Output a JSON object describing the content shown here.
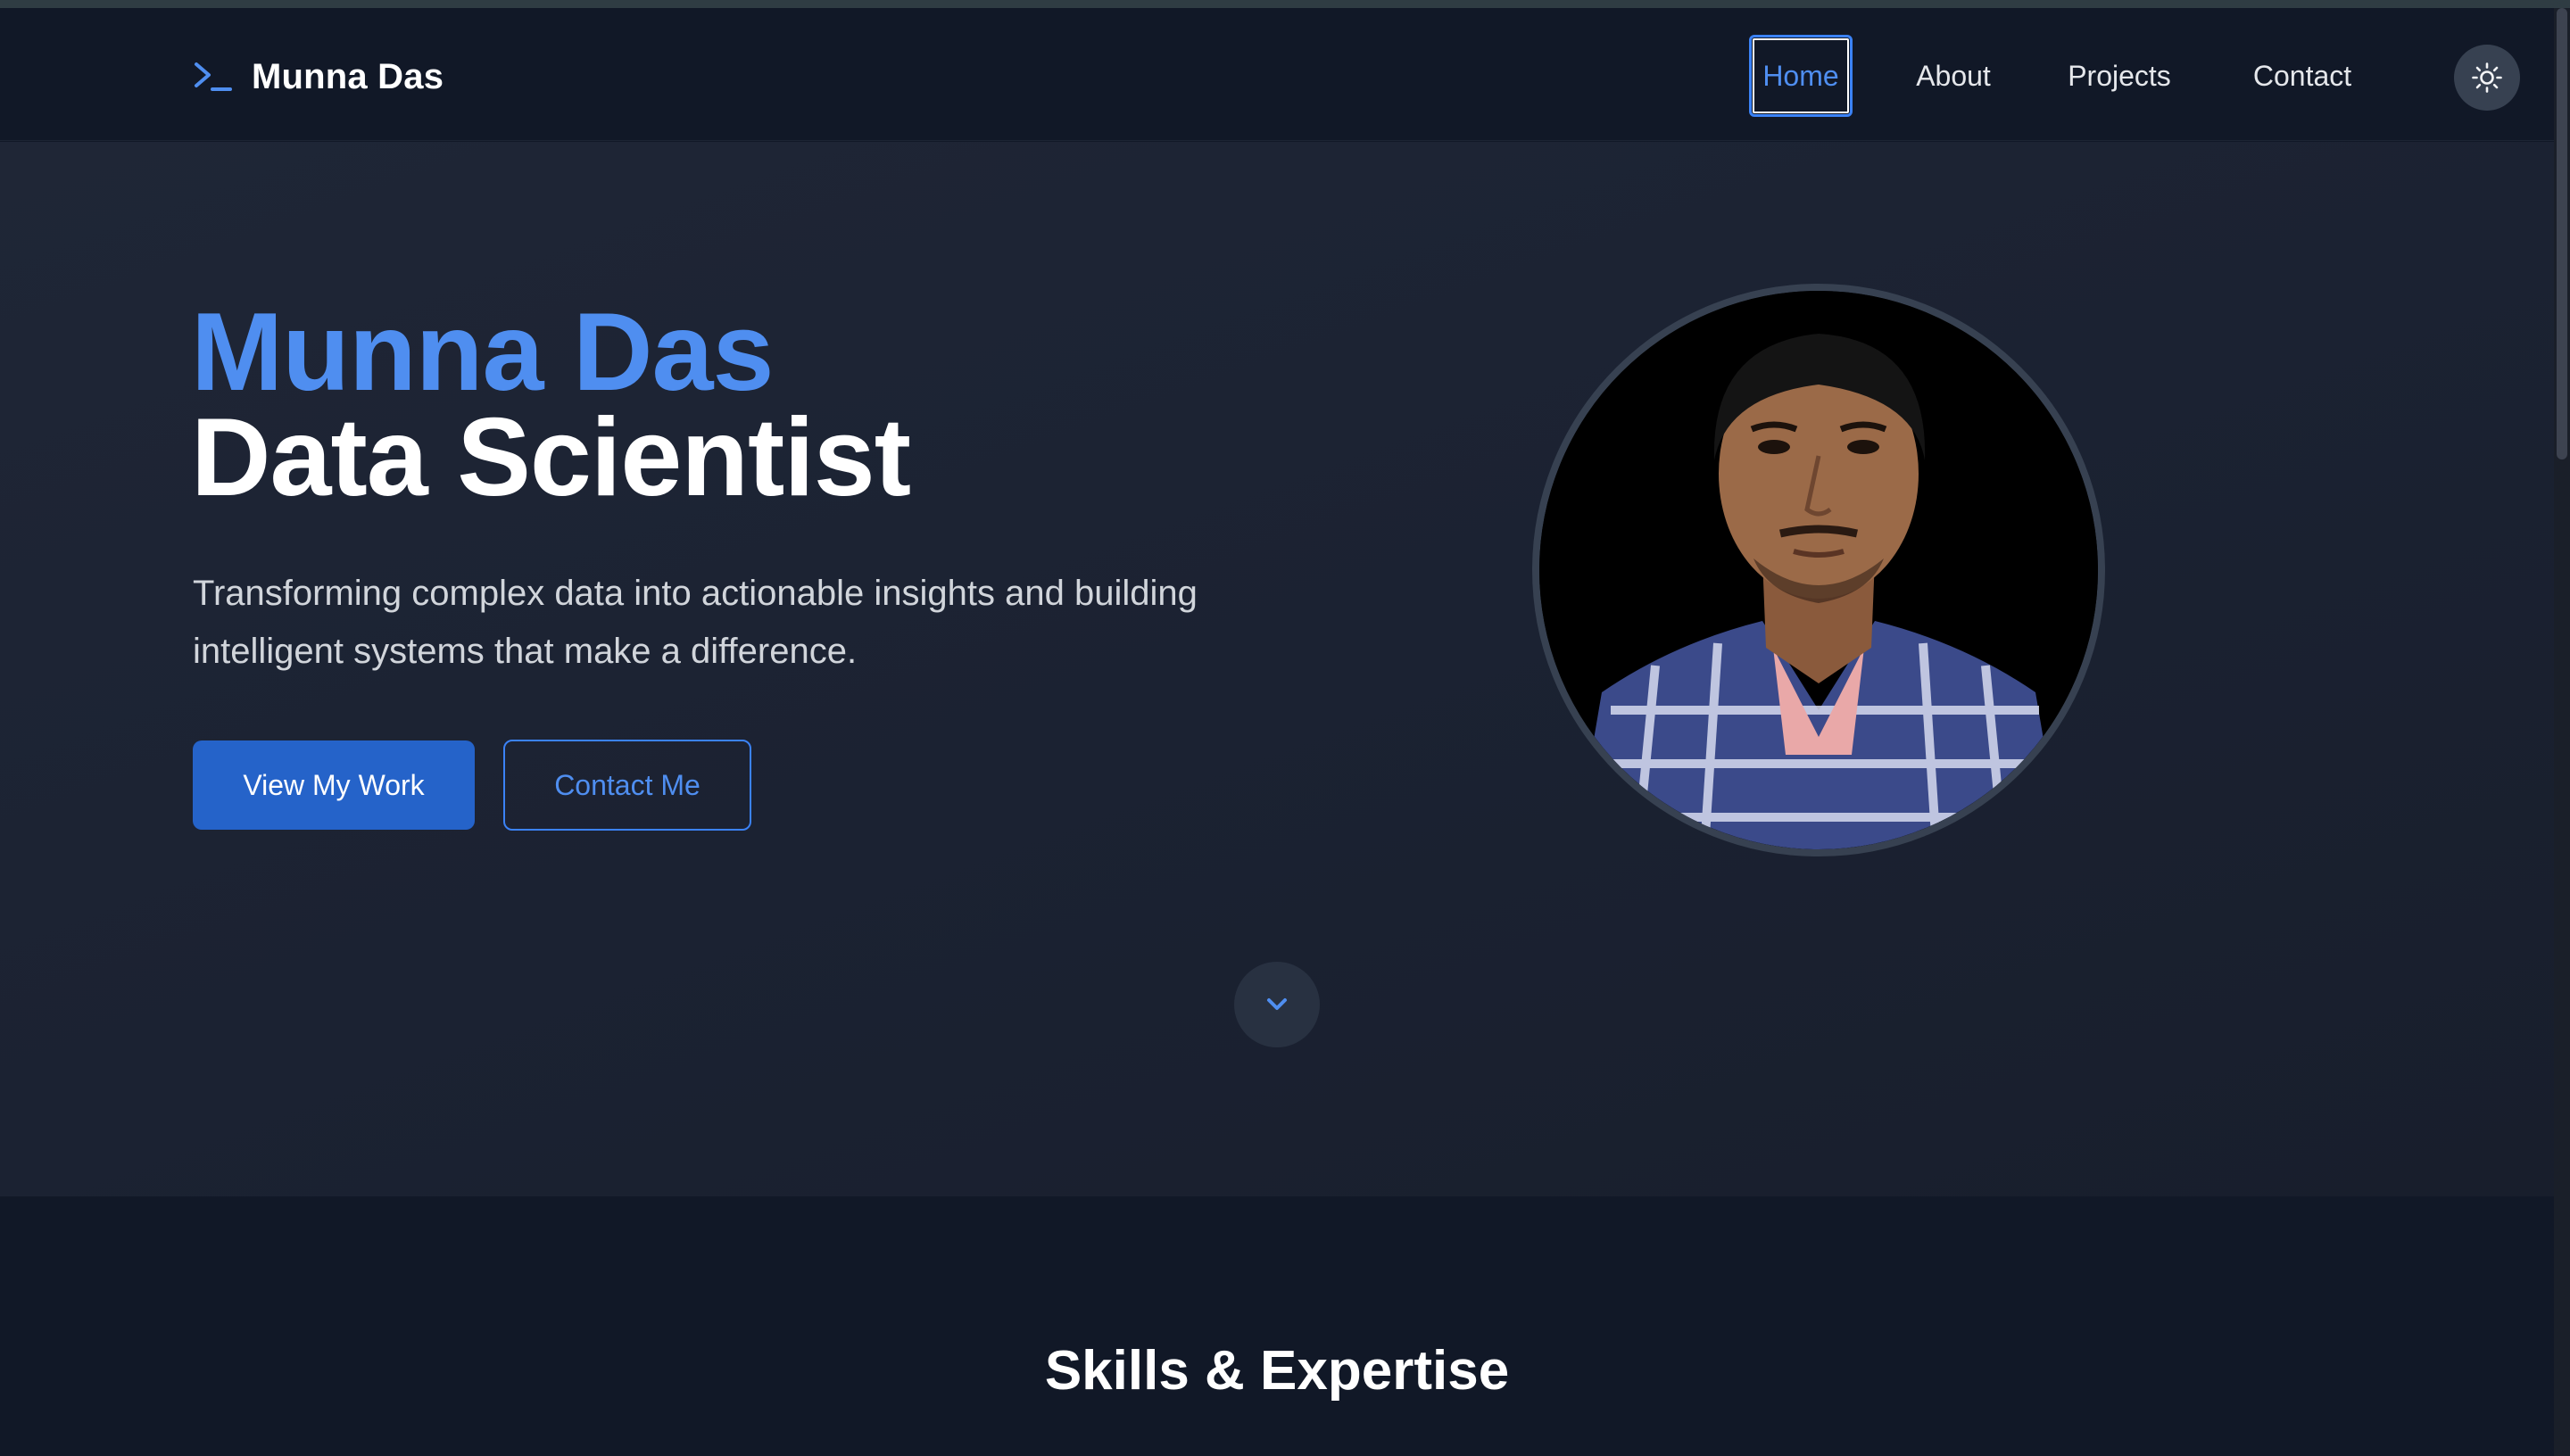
{
  "nav": {
    "brand_prompt": ">_",
    "brand_name": "Munna Das",
    "links": [
      "Home",
      "About",
      "Projects",
      "Contact"
    ],
    "active": "Home",
    "theme_toggle_icon": "sun-icon"
  },
  "hero": {
    "name": "Munna Das",
    "role": "Data Scientist",
    "description": "Transforming complex data into actionable insights and building intelligent systems that make a difference.",
    "primary_button": "View My Work",
    "secondary_button": "Contact Me",
    "scroll_icon": "chevron-down-icon"
  },
  "skills": {
    "title": "Skills & Expertise"
  },
  "colors": {
    "accent": "#4f8ef0",
    "primary_button": "#2563c9",
    "background": "#111827",
    "hero_background": "#1c2333"
  }
}
